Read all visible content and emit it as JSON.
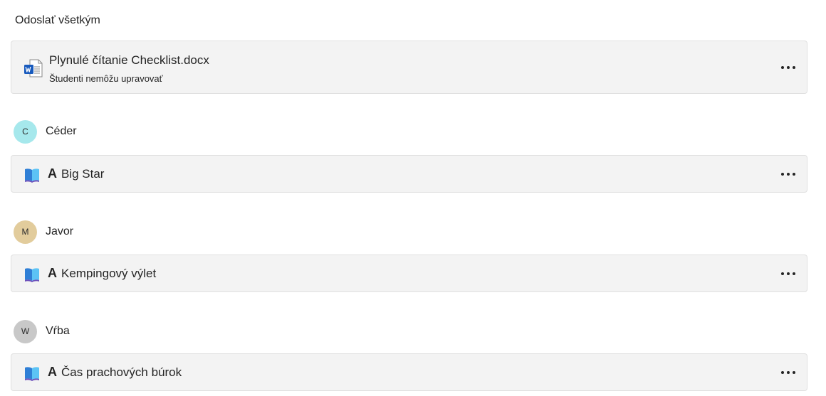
{
  "section": {
    "title": "Odoslať všetkým"
  },
  "file": {
    "name": "Plynulé čítanie Checklist.docx",
    "subtitle": "Študenti nemôžu upravovať",
    "icon": "word-document-icon"
  },
  "groups": [
    {
      "initial": "C",
      "name": "Céder",
      "avatar_color": "#a6e8ec",
      "book_level": "A",
      "book_title": "Big Star"
    },
    {
      "initial": "M",
      "name": "Javor",
      "avatar_color": "#e2cc9c",
      "book_level": "A",
      "book_title": "Kempingový výlet"
    },
    {
      "initial": "W",
      "name": "Vŕba",
      "avatar_color": "#c8c8c8",
      "book_level": "A",
      "book_title": "Čas prachových búrok"
    }
  ],
  "colors": {
    "card_bg": "#f3f3f3",
    "card_border": "#e0e0e0",
    "book_icon": "#3aa0f3",
    "word_blue": "#185abd"
  }
}
